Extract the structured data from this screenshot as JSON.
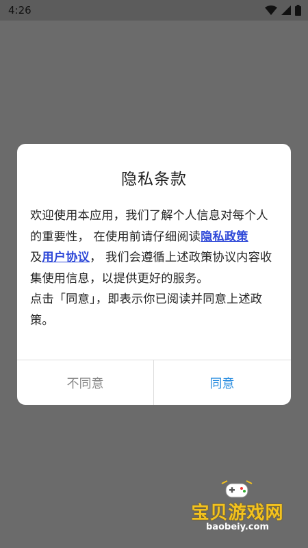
{
  "status_bar": {
    "time": "4:26"
  },
  "dialog": {
    "title": "隐私条款",
    "body_part1": "欢迎使用本应用，我们了解个人信息对每个人的重要性， 在使用前请仔细阅读",
    "privacy_link": "隐私政策",
    "body_part2": "及",
    "terms_link": "用户协议",
    "body_part3": "， 我们会遵循上述政策协议内容收集使用信息，以提供更好的服务。",
    "body_part4": "点击「同意」，即表示你已阅读并同意上述政策。",
    "disagree_label": "不同意",
    "agree_label": "同意",
    "colors": {
      "link": "#2f49d8",
      "agree": "#2d8fe0",
      "disagree": "#8a8a8a"
    }
  },
  "watermark": {
    "name": "宝贝游戏网",
    "url": "baobeiy.com",
    "icon": "gamepad-icon"
  }
}
